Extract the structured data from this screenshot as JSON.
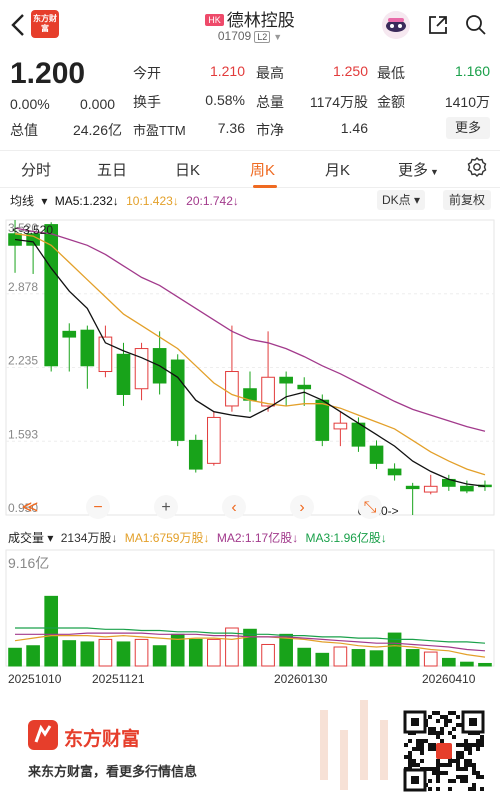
{
  "header": {
    "brand": "东方财富",
    "market_badge": "HK",
    "stock_name": "德林控股",
    "stock_code": "01709",
    "level_badge": "L2"
  },
  "quote": {
    "price": "1.200",
    "change_pct": "0.00%",
    "change_abs": "0.000",
    "market_cap_label": "总值",
    "market_cap": "24.26亿",
    "open_label": "今开",
    "open": "1.210",
    "high_label": "最高",
    "high": "1.250",
    "low_label": "最低",
    "low": "1.160",
    "turnover_label": "换手",
    "turnover": "0.58%",
    "volume_label": "总量",
    "volume": "1174万股",
    "amount_label": "金额",
    "amount": "1410万",
    "pe_label": "市盈TTM",
    "pe": "7.36",
    "pb_label": "市净",
    "pb": "1.46",
    "more_label": "更多"
  },
  "tabs": [
    {
      "label": "分时"
    },
    {
      "label": "五日"
    },
    {
      "label": "日K"
    },
    {
      "label": "周K"
    },
    {
      "label": "月K"
    },
    {
      "label": "更多"
    }
  ],
  "active_tab": "周K",
  "indicator": {
    "selector": "均线",
    "ma5": "MA5:1.232↓",
    "ma10": "10:1.423↓",
    "ma20": "20:1.742↓",
    "dk_label": "DK点",
    "adjust_label": "前复权"
  },
  "volume_indicator": {
    "selector": "成交量",
    "vol": "2134万股↓",
    "ma1": "MA1:6759万股↓",
    "ma2": "MA2:1.17亿股↓",
    "ma3": "MA3:1.96亿股↓",
    "max_label": "9.16亿"
  },
  "colors": {
    "up": "#e23b3b",
    "down": "#18a31a",
    "ma5": "#111111",
    "ma10": "#e3a02a",
    "ma20": "#a23a8c",
    "accent": "#ef6a21"
  },
  "chart_data": {
    "type": "candlestick",
    "y_ticks": [
      "3.520",
      "2.878",
      "2.235",
      "1.593",
      "0.950"
    ],
    "ylim": [
      0.95,
      3.52
    ],
    "high_marker": "<-3.520",
    "low_marker": "0.950->",
    "x_labels": [
      "20251010",
      "20251121",
      "20260130",
      "20260410"
    ],
    "candles": [
      {
        "o": 3.4,
        "c": 3.3,
        "h": 3.52,
        "l": 3.06
      },
      {
        "o": 3.4,
        "c": 3.3,
        "h": 3.38,
        "l": 3.05
      },
      {
        "o": 3.48,
        "c": 2.25,
        "h": 3.5,
        "l": 2.2
      },
      {
        "o": 2.55,
        "c": 2.5,
        "h": 2.62,
        "l": 2.2
      },
      {
        "o": 2.56,
        "c": 2.25,
        "h": 2.6,
        "l": 2.05
      },
      {
        "o": 2.2,
        "c": 2.5,
        "h": 2.6,
        "l": 2.15
      },
      {
        "o": 2.35,
        "c": 2.0,
        "h": 2.45,
        "l": 1.9
      },
      {
        "o": 2.05,
        "c": 2.4,
        "h": 2.45,
        "l": 1.95
      },
      {
        "o": 2.4,
        "c": 2.1,
        "h": 2.55,
        "l": 2.0
      },
      {
        "o": 2.3,
        "c": 1.6,
        "h": 2.35,
        "l": 1.55
      },
      {
        "o": 1.6,
        "c": 1.35,
        "h": 1.65,
        "l": 1.32
      },
      {
        "o": 1.4,
        "c": 1.8,
        "h": 1.85,
        "l": 1.38
      },
      {
        "o": 1.9,
        "c": 2.2,
        "h": 2.6,
        "l": 1.85
      },
      {
        "o": 2.05,
        "c": 1.95,
        "h": 2.2,
        "l": 1.85
      },
      {
        "o": 1.9,
        "c": 2.15,
        "h": 2.55,
        "l": 1.85
      },
      {
        "o": 2.15,
        "c": 2.1,
        "h": 2.2,
        "l": 1.9
      },
      {
        "o": 2.08,
        "c": 2.05,
        "h": 2.15,
        "l": 1.9
      },
      {
        "o": 1.95,
        "c": 1.6,
        "h": 2.0,
        "l": 1.55
      },
      {
        "o": 1.7,
        "c": 1.75,
        "h": 1.85,
        "l": 1.55
      },
      {
        "o": 1.75,
        "c": 1.55,
        "h": 1.8,
        "l": 1.5
      },
      {
        "o": 1.55,
        "c": 1.4,
        "h": 1.6,
        "l": 1.35
      },
      {
        "o": 1.35,
        "c": 1.3,
        "h": 1.4,
        "l": 1.25
      },
      {
        "o": 1.2,
        "c": 1.18,
        "h": 1.23,
        "l": 0.95
      },
      {
        "o": 1.15,
        "c": 1.2,
        "h": 1.3,
        "l": 1.13
      },
      {
        "o": 1.26,
        "c": 1.2,
        "h": 1.3,
        "l": 1.16
      },
      {
        "o": 1.2,
        "c": 1.16,
        "h": 1.25,
        "l": 1.14
      },
      {
        "o": 1.21,
        "c": 1.2,
        "h": 1.25,
        "l": 1.16
      }
    ],
    "ma5": [
      3.35,
      3.33,
      3.1,
      2.9,
      2.75,
      2.45,
      2.38,
      2.32,
      2.25,
      2.15,
      1.95,
      1.85,
      1.82,
      1.8,
      1.88,
      1.98,
      2.02,
      1.95,
      1.85,
      1.75,
      1.65,
      1.55,
      1.42,
      1.33,
      1.26,
      1.22,
      1.2
    ],
    "ma10": [
      3.4,
      3.38,
      3.3,
      3.15,
      3.0,
      2.85,
      2.7,
      2.6,
      2.5,
      2.4,
      2.25,
      2.1,
      2.0,
      1.95,
      1.92,
      1.9,
      1.92,
      1.92,
      1.88,
      1.82,
      1.76,
      1.7,
      1.6,
      1.5,
      1.42,
      1.35,
      1.3
    ],
    "ma20": [
      3.45,
      3.42,
      3.4,
      3.35,
      3.3,
      3.22,
      3.12,
      3.02,
      2.95,
      2.85,
      2.75,
      2.65,
      2.55,
      2.48,
      2.45,
      2.4,
      2.33,
      2.25,
      2.18,
      2.1,
      2.02,
      1.94,
      1.87,
      1.82,
      1.77,
      1.72,
      1.68
    ],
    "volumes": [
      1.4,
      1.6,
      5.5,
      2.0,
      1.9,
      2.1,
      1.9,
      2.1,
      1.6,
      2.5,
      2.1,
      2.1,
      3.0,
      2.9,
      1.7,
      2.5,
      1.4,
      1.0,
      1.5,
      1.3,
      1.2,
      2.6,
      1.3,
      1.1,
      0.6,
      0.3,
      0.2
    ],
    "vol_ma1": [
      2.0,
      2.2,
      2.4,
      2.4,
      2.4,
      2.3,
      2.4,
      2.3,
      2.2,
      2.1,
      2.2,
      2.2,
      2.1,
      2.3,
      2.3,
      2.2,
      2.1,
      1.9,
      1.8,
      1.6,
      1.5,
      1.6,
      1.5,
      1.3,
      1.2,
      0.9,
      0.7
    ],
    "vol_ma2": [
      2.5,
      2.5,
      2.5,
      2.5,
      2.6,
      2.6,
      2.6,
      2.6,
      2.5,
      2.5,
      2.5,
      2.4,
      2.4,
      2.3,
      2.3,
      2.3,
      2.2,
      2.1,
      2.0,
      1.9,
      1.8,
      1.8,
      1.7,
      1.6,
      1.5,
      1.3,
      1.2
    ],
    "vol_ma3": [
      3.0,
      3.0,
      3.0,
      3.0,
      3.0,
      2.9,
      2.9,
      2.8,
      2.8,
      2.7,
      2.7,
      2.6,
      2.6,
      2.5,
      2.5,
      2.4,
      2.4,
      2.3,
      2.3,
      2.2,
      2.2,
      2.1,
      2.1,
      2.0,
      1.9,
      1.9,
      1.8
    ],
    "vol_max": 9.16
  },
  "footer": {
    "brand": "东方财富",
    "slogan": "来东方财富，看更多行情信息"
  }
}
